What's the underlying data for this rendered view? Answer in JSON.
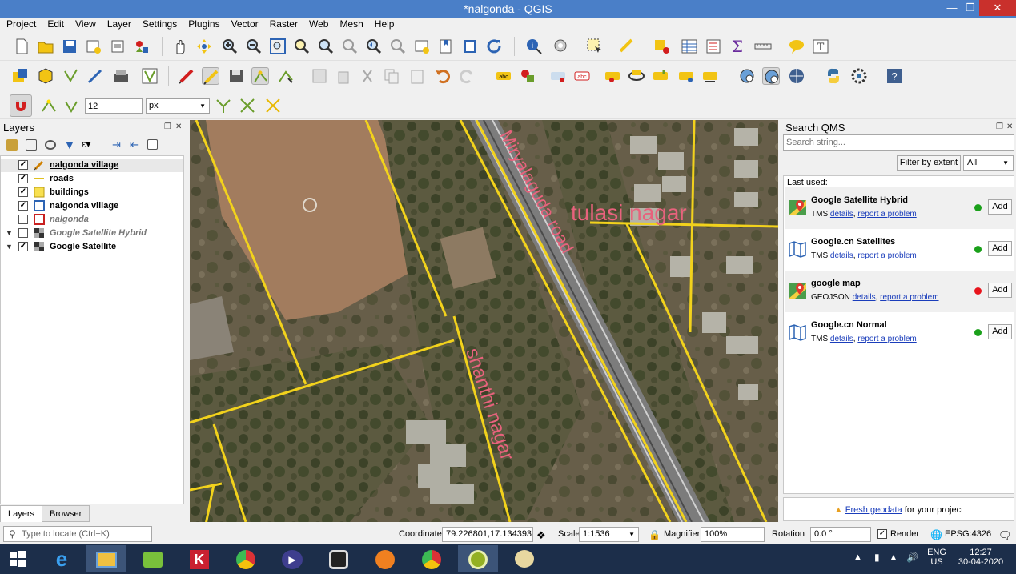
{
  "window": {
    "title": "*nalgonda - QGIS"
  },
  "menu": [
    "Project",
    "Edit",
    "View",
    "Layer",
    "Settings",
    "Plugins",
    "Vector",
    "Raster",
    "Web",
    "Mesh",
    "Help"
  ],
  "snapping": {
    "tolerance": "12",
    "unit": "px"
  },
  "layers_panel": {
    "title": "Layers",
    "items": [
      {
        "label": "nalgonda village",
        "checked": true,
        "italic": false,
        "underline": true,
        "symbol": "edit-pencil-icon"
      },
      {
        "label": "roads",
        "checked": true,
        "italic": false,
        "underline": false,
        "symbol": "line-symbol"
      },
      {
        "label": "buildings",
        "checked": true,
        "italic": false,
        "underline": false,
        "symbol": "fill-yellow"
      },
      {
        "label": "nalgonda village",
        "checked": true,
        "italic": false,
        "underline": false,
        "symbol": "outline-blue"
      },
      {
        "label": "nalgonda",
        "checked": false,
        "italic": true,
        "underline": false,
        "symbol": "outline-red"
      },
      {
        "label": "Google Satellite Hybrid",
        "checked": false,
        "italic": true,
        "underline": false,
        "symbol": "raster"
      },
      {
        "label": "Google Satellite",
        "checked": true,
        "italic": false,
        "underline": false,
        "symbol": "raster"
      }
    ],
    "tabs": [
      "Layers",
      "Browser"
    ]
  },
  "map": {
    "labels": [
      "tulasi nagar",
      "shanthi nagar",
      "Miryalaguda road"
    ]
  },
  "qms": {
    "title": "Search QMS",
    "search_placeholder": "Search string...",
    "filter_btn": "Filter by extent",
    "filter_value": "All",
    "last_used": "Last used:",
    "items": [
      {
        "name": "Google Satellite Hybrid",
        "type": "TMS",
        "status": "#1aa01a",
        "icon": "google-maps-icon"
      },
      {
        "name": "Google.cn Satellites",
        "type": "TMS",
        "status": "#1aa01a",
        "icon": "map-icon"
      },
      {
        "name": "google map",
        "type": "GEOJSON",
        "status": "#e8141c",
        "icon": "google-maps-icon"
      },
      {
        "name": "Google.cn Normal",
        "type": "TMS",
        "status": "#1aa01a",
        "icon": "map-icon"
      }
    ],
    "details_label": "details",
    "report_label": "report a problem",
    "add_label": "Add",
    "fresh_link": "Fresh geodata",
    "fresh_suffix": " for your project"
  },
  "status": {
    "locate_placeholder": "Type to locate (Ctrl+K)",
    "coordinate_label": "Coordinate",
    "coordinate_value": "79.226801,17.134393",
    "scale_label": "Scale",
    "scale_value": "1:1536",
    "magnifier_label": "Magnifier",
    "magnifier_value": "100%",
    "rotation_label": "Rotation",
    "rotation_value": "0.0 °",
    "render_label": "Render",
    "crs": "EPSG:4326"
  },
  "taskbar": {
    "lang": "ENG",
    "region": "US",
    "time": "12:27",
    "date": "30-04-2020"
  }
}
